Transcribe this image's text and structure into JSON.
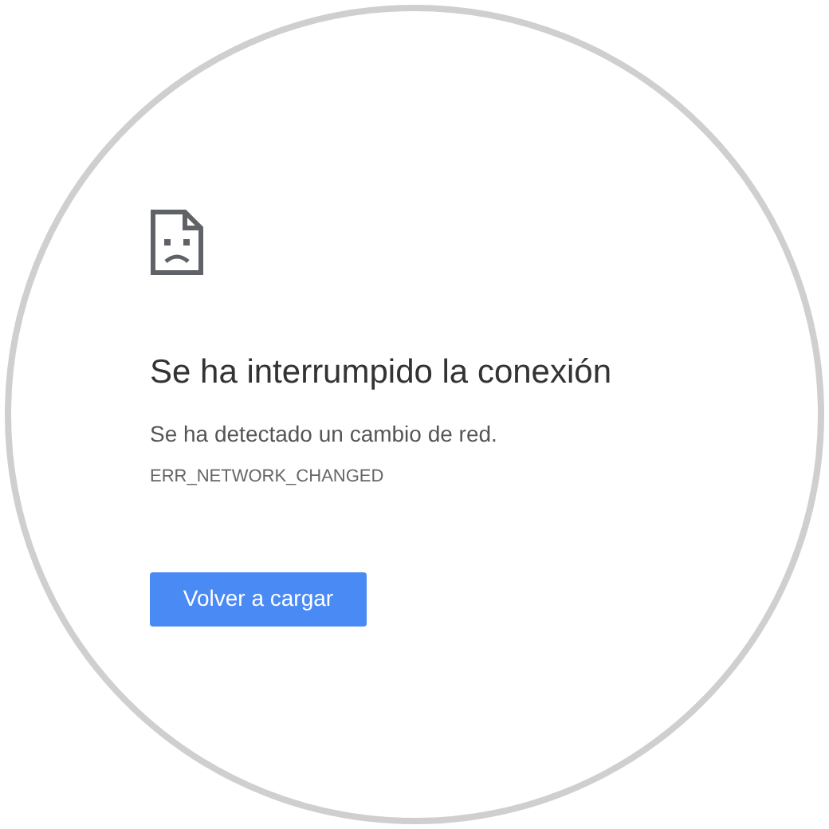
{
  "error_page": {
    "title": "Se ha interrumpido la conexión",
    "message": "Se ha detectado un cambio de red.",
    "error_code": "ERR_NETWORK_CHANGED",
    "button": "Volver a cargar"
  }
}
